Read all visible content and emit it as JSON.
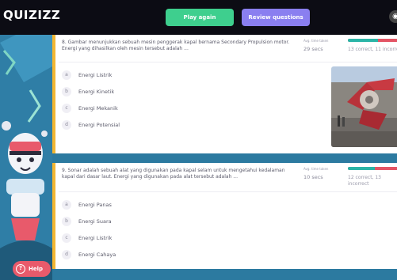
{
  "header": {
    "logo": "QUIZIZZ",
    "play_again": "Play again",
    "review_questions": "Review questions"
  },
  "questions": [
    {
      "text": "8. Gambar menunjukkan sebuah mesin penggerak kapal bernama Secondary Propulsion motor. Energi yang dihasilkan oleh mesin tersebut adalah ...",
      "avg_time_label": "Avg. time taken",
      "avg_time": "29 secs",
      "accuracy_text": "13 correct, 11 incorrect",
      "accuracy_fraction": 0.54,
      "options": [
        {
          "letter": "a",
          "text": "Energi Listrik"
        },
        {
          "letter": "b",
          "text": "Energi Kinetik"
        },
        {
          "letter": "c",
          "text": "Energi Mekanik"
        },
        {
          "letter": "d",
          "text": "Energi Potensial"
        }
      ]
    },
    {
      "text": "9. Sonar adalah sebuah alat yang digunakan pada kapal selam untuk mengetahui kedalaman kapal dari dasar laut. Energi yang digunakan pada alat tersebut adalah ...",
      "avg_time_label": "Avg. time taken",
      "avg_time": "10 secs",
      "accuracy_text": "12 correct, 13 incorrect",
      "accuracy_fraction": 0.48,
      "options": [
        {
          "letter": "a",
          "text": "Energi Panas"
        },
        {
          "letter": "b",
          "text": "Energi Suara"
        },
        {
          "letter": "c",
          "text": "Energi Listrik"
        },
        {
          "letter": "d",
          "text": "Energi Cahaya"
        }
      ]
    }
  ],
  "help": {
    "label": "Help",
    "icon": "question-icon"
  },
  "colors": {
    "accent_green": "#3ecf8e",
    "accent_purple": "#8a7ff0",
    "correct": "#2bb5a7",
    "incorrect": "#e35565",
    "card_border": "#f2b632"
  }
}
